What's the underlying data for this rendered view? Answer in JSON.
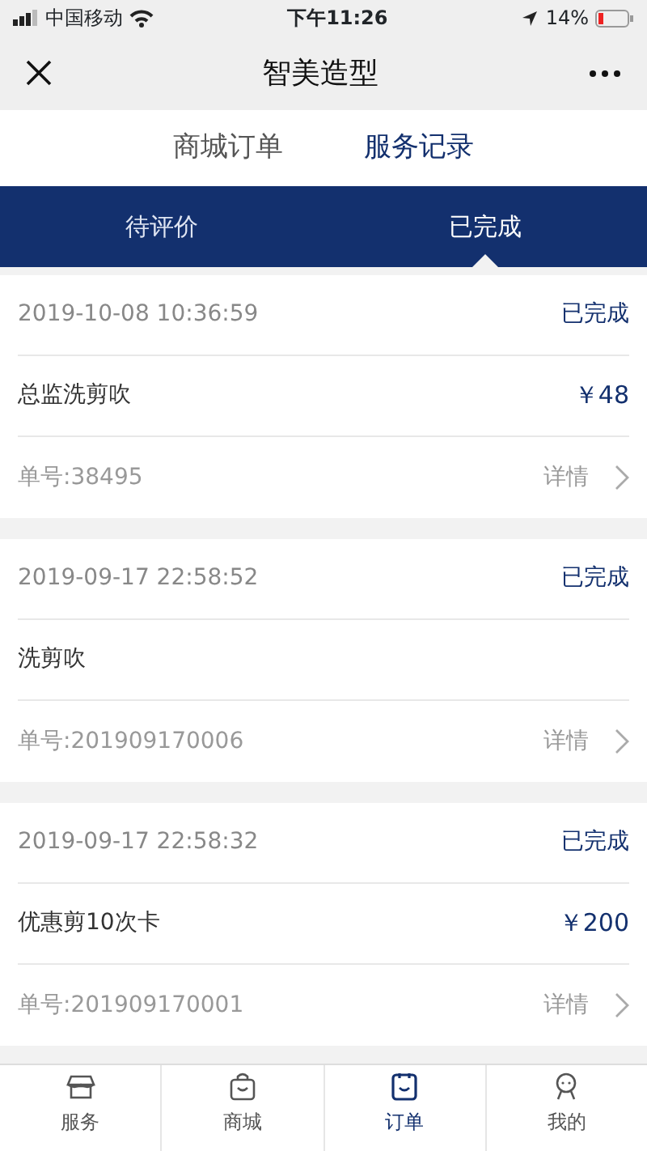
{
  "status_bar": {
    "carrier": "中国移动",
    "time": "下午11:26",
    "battery": "14%"
  },
  "header": {
    "title": "智美造型"
  },
  "top_tabs": [
    {
      "label": "商城订单",
      "selected": false
    },
    {
      "label": "服务记录",
      "selected": true
    }
  ],
  "sub_tabs": [
    {
      "label": "待评价",
      "selected": false
    },
    {
      "label": "已完成",
      "selected": true
    }
  ],
  "orders": [
    {
      "datetime": "2019-10-08 10:36:59",
      "status": "已完成",
      "service": "总监洗剪吹",
      "price": "￥48",
      "order_no": "单号:38495",
      "details": "详情"
    },
    {
      "datetime": "2019-09-17 22:58:52",
      "status": "已完成",
      "service": "洗剪吹",
      "order_no": "单号:201909170006",
      "details": "详情"
    },
    {
      "datetime": "2019-09-17 22:58:32",
      "status": "已完成",
      "service": "优惠剪10次卡",
      "price": "￥200",
      "order_no": "单号:201909170001",
      "details": "详情"
    }
  ],
  "bottom_nav": [
    {
      "kind": "shop",
      "label": "服务",
      "selected": false
    },
    {
      "kind": "bag",
      "label": "商城",
      "selected": false
    },
    {
      "kind": "clipboard",
      "label": "订单",
      "selected": true
    },
    {
      "kind": "person",
      "label": "我的",
      "selected": false
    }
  ]
}
